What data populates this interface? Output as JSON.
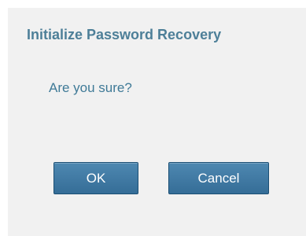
{
  "dialog": {
    "title": "Initialize Password Recovery",
    "message": "Are you sure?",
    "ok_label": "OK",
    "cancel_label": "Cancel"
  },
  "colors": {
    "title": "#4d7f98",
    "message": "#3f7a97",
    "button_top": "#4e88b1",
    "button_bottom": "#356d97",
    "dialog_background": "#f1f1f1"
  }
}
